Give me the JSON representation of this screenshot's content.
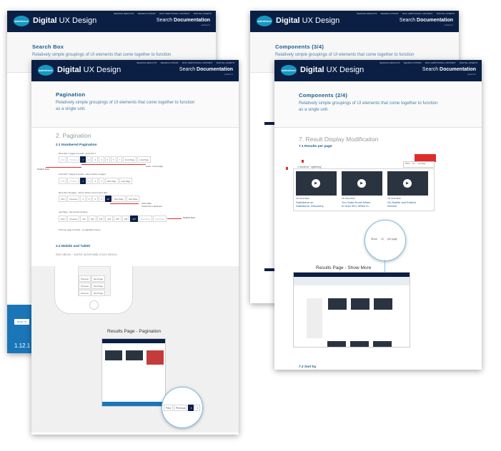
{
  "brand": {
    "name_bold": "Digital",
    "name_rest": " UX Design",
    "logo": "salesforce"
  },
  "header": {
    "search_label": "Search",
    "search_bold": "Documentation",
    "version": "version 0.1",
    "top_links": [
      "SEARCH RESULTS",
      "SEARCH INTENT",
      "DOC ADDITIONAL CONTENT",
      "DIGITAL ASSETS"
    ]
  },
  "back_left": {
    "intro_title": "Search Box",
    "intro_desc": "Relatively simple groupings of UI elements that come together to function",
    "back_button": "BACK TO",
    "version_num": "1.12.1"
  },
  "back_right": {
    "intro_title": "Components (3/4)",
    "intro_desc": "Relatively simple groupings of UI elements that come together to function"
  },
  "front_left": {
    "intro_title": "Pagination",
    "intro_desc_1": "Relatively simple groupings of UI elements that come together to function",
    "intro_desc_2": "as a single unit.",
    "section_title": "2. Pagination",
    "sub1": "2.1 Numbered Pagination",
    "sub2": "2.2 Mobile and Tablet",
    "sub2_desc": "See above - works universally cross device",
    "notes": {
      "n1": "More than 7 pages of results - show first 7",
      "n2": "Less than 7 pages of results - show number of pages",
      "n3": "More than 10 pages - show 2 before current and 2 after",
      "n4": "Last Page - last several showing",
      "n5": "Only one page of results - no pagination shown",
      "disabled": "Disabled State",
      "active": "Active - current page",
      "hover": "Hover State,",
      "hover2": "number item / active item",
      "disabled2": "Disabled State"
    },
    "pager1": [
      "First",
      "Previous",
      "1",
      "2",
      "3",
      "4",
      "5",
      "6",
      "7",
      "Next Page",
      "Last Page"
    ],
    "pager2": [
      "First",
      "Previous",
      "1",
      "2",
      "3",
      "4",
      "Next Page",
      "Last Page"
    ],
    "pager3": [
      "First",
      "Previous",
      "3",
      "4",
      "5",
      "6",
      "10",
      "Next Page",
      "Last Page"
    ],
    "pager4": [
      "First",
      "Previous",
      "221",
      "222",
      "223",
      "224",
      "225",
      "226",
      "227",
      "Next Page",
      "Last Page"
    ],
    "mobile_buttons": [
      "Previous",
      "Next Page"
    ],
    "caption": "Results Page - Pagination",
    "zoom_pager": [
      "First",
      "Previous",
      "1",
      "2"
    ]
  },
  "front_right": {
    "intro_title": "Components (2/4)",
    "intro_desc_1": "Relatively simple groupings of UI elements that come together to function",
    "intro_desc_2": "as a single unit.",
    "section_title": "7. Result Display Modificaiton",
    "sub1": "7.1 Results per page",
    "results_label": "1 result for \"Lightning\"",
    "show_label": "Show",
    "per_page": "per page",
    "show_count": "12",
    "cards": [
      {
        "tag": "VID TRAILHEAD",
        "title": "Salesforce on",
        "title2": "Salesforce: Discovery"
      },
      {
        "tag": "VID TRAILHEAD",
        "title": "You Gotta Know When",
        "title2": "to Hold 'Em: When to"
      },
      {
        "tag": "VID TRAILHEAD",
        "title": "Go Mobile and Embed",
        "title2": "Service"
      }
    ],
    "caption": "Results Page - Show More",
    "sub2": "7.2 Sort by"
  }
}
